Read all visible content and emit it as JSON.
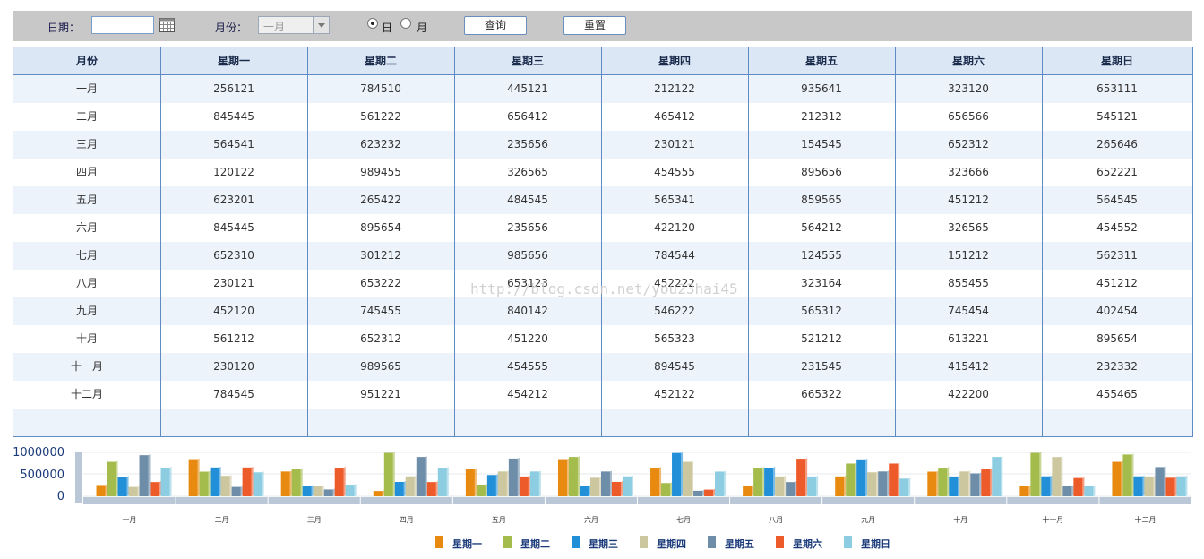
{
  "toolbar": {
    "date_label": "日期：",
    "date_value": "",
    "calendar_icon": "calendar-icon",
    "month_label": "月份：",
    "month_value": "一月",
    "radio_day_label": "日",
    "radio_month_label": "月",
    "radio_selected": "日",
    "query_button": "查询",
    "reset_button": "重置"
  },
  "table": {
    "columns": [
      "月份",
      "星期一",
      "星期二",
      "星期三",
      "星期四",
      "星期五",
      "星期六",
      "星期日"
    ],
    "rows": [
      [
        "一月",
        "256121",
        "784510",
        "445121",
        "212122",
        "935641",
        "323120",
        "653111"
      ],
      [
        "二月",
        "845445",
        "561222",
        "656412",
        "465412",
        "212312",
        "656566",
        "545121"
      ],
      [
        "三月",
        "564541",
        "623232",
        "235656",
        "230121",
        "154545",
        "652312",
        "265646"
      ],
      [
        "四月",
        "120122",
        "989455",
        "326565",
        "454555",
        "895656",
        "323666",
        "652221"
      ],
      [
        "五月",
        "623201",
        "265422",
        "484545",
        "565341",
        "859565",
        "451212",
        "564545"
      ],
      [
        "六月",
        "845445",
        "895654",
        "235656",
        "422120",
        "564212",
        "326565",
        "454552"
      ],
      [
        "七月",
        "652310",
        "301212",
        "985656",
        "784544",
        "124555",
        "151212",
        "562311"
      ],
      [
        "八月",
        "230121",
        "653222",
        "653123",
        "452222",
        "323164",
        "855455",
        "451212"
      ],
      [
        "九月",
        "452120",
        "745455",
        "840142",
        "546222",
        "565312",
        "745454",
        "402454"
      ],
      [
        "十月",
        "561212",
        "652312",
        "451220",
        "565323",
        "521212",
        "613221",
        "895654"
      ],
      [
        "十一月",
        "230120",
        "989565",
        "454555",
        "894545",
        "231545",
        "415412",
        "232332"
      ],
      [
        "十二月",
        "784545",
        "951221",
        "454212",
        "452122",
        "665322",
        "422200",
        "455465"
      ]
    ]
  },
  "watermark": "http://blog.csdn.net/you23hai45",
  "colors": {
    "header_bg": "#dce7f5",
    "row_alt": "#edf3fb",
    "border": "#5f8bc3"
  },
  "chart_data": {
    "type": "bar",
    "categories": [
      "一月",
      "二月",
      "三月",
      "四月",
      "五月",
      "六月",
      "七月",
      "八月",
      "九月",
      "十月",
      "十一月",
      "十二月"
    ],
    "yticks": [
      "1000000",
      "500000",
      "0"
    ],
    "ylim": [
      0,
      1000000
    ],
    "legend_position": "bottom",
    "series": [
      {
        "name": "星期一",
        "color": "#e88a0f",
        "values": [
          256121,
          845445,
          564541,
          120122,
          623201,
          845445,
          652310,
          230121,
          452120,
          561212,
          230120,
          784545
        ]
      },
      {
        "name": "星期二",
        "color": "#a3bc4c",
        "values": [
          784510,
          561222,
          623232,
          989455,
          265422,
          895654,
          301212,
          653222,
          745455,
          652312,
          989565,
          951221
        ]
      },
      {
        "name": "星期三",
        "color": "#2190d8",
        "values": [
          445121,
          656412,
          235656,
          326565,
          484545,
          235656,
          985656,
          653123,
          840142,
          451220,
          454555,
          454212
        ]
      },
      {
        "name": "星期四",
        "color": "#cdc79f",
        "values": [
          212122,
          465412,
          230121,
          454555,
          565341,
          422120,
          784544,
          452222,
          546222,
          565323,
          894545,
          452122
        ]
      },
      {
        "name": "星期五",
        "color": "#6e8da8",
        "values": [
          935641,
          212312,
          154545,
          895656,
          859565,
          564212,
          124555,
          323164,
          565312,
          521212,
          231545,
          665322
        ]
      },
      {
        "name": "星期六",
        "color": "#ee5b2b",
        "values": [
          323120,
          656566,
          652312,
          323666,
          451212,
          326565,
          151212,
          855455,
          745454,
          613221,
          415412,
          422200
        ]
      },
      {
        "name": "星期日",
        "color": "#8ccde2",
        "values": [
          653111,
          545121,
          265646,
          652221,
          564545,
          454552,
          562311,
          451212,
          402454,
          895654,
          232332,
          455465
        ]
      }
    ]
  }
}
